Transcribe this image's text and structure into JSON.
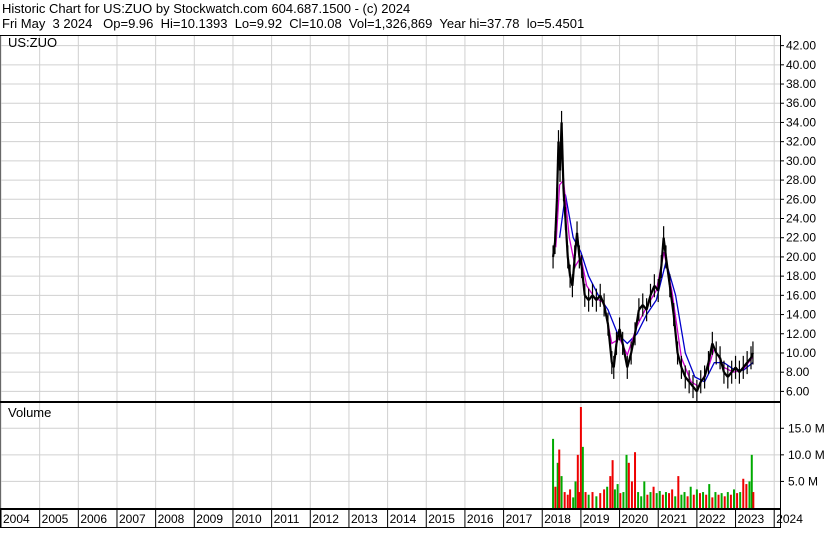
{
  "header": {
    "line1": "Historic Chart for US:ZUO by Stockwatch.com 604.687.1500 - (c) 2024",
    "line2": "Fri May  3 2024   Op=9.96  Hi=10.1393  Lo=9.92  Cl=10.08  Vol=1,326,869  Year hi=37.78  lo=5.4501"
  },
  "chart_data": {
    "type": "line",
    "symbol_label": "US:ZUO",
    "volume_label": "Volume",
    "x_tick_labels": [
      "2004",
      "2005",
      "2006",
      "2007",
      "2008",
      "2009",
      "2010",
      "2011",
      "2012",
      "2013",
      "2014",
      "2015",
      "2016",
      "2017",
      "2018",
      "2019",
      "2020",
      "2021",
      "2022",
      "2023",
      "2024"
    ],
    "price_axis": {
      "ylim": [
        5,
        43
      ],
      "tick_labels": [
        "42.00",
        "40.00",
        "38.00",
        "36.00",
        "34.00",
        "32.00",
        "30.00",
        "28.00",
        "26.00",
        "24.00",
        "22.00",
        "20.00",
        "18.00",
        "16.00",
        "14.00",
        "12.00",
        "10.00",
        "8.00",
        "6.00"
      ]
    },
    "volume_axis": {
      "ylim": [
        0,
        19000000
      ],
      "tick_labels": [
        "15.0 M",
        "10.0 M",
        "5.0 M"
      ]
    },
    "price_points": [
      {
        "x": 2018.28,
        "y": 20.0
      },
      {
        "x": 2018.33,
        "y": 21.5
      },
      {
        "x": 2018.38,
        "y": 26.0
      },
      {
        "x": 2018.42,
        "y": 32.0
      },
      {
        "x": 2018.46,
        "y": 29.0
      },
      {
        "x": 2018.5,
        "y": 34.0
      },
      {
        "x": 2018.55,
        "y": 27.0
      },
      {
        "x": 2018.6,
        "y": 24.0
      },
      {
        "x": 2018.66,
        "y": 20.0
      },
      {
        "x": 2018.72,
        "y": 18.0
      },
      {
        "x": 2018.78,
        "y": 17.0
      },
      {
        "x": 2018.84,
        "y": 20.0
      },
      {
        "x": 2018.9,
        "y": 22.5
      },
      {
        "x": 2018.96,
        "y": 20.0
      },
      {
        "x": 2019.02,
        "y": 19.0
      },
      {
        "x": 2019.1,
        "y": 16.0
      },
      {
        "x": 2019.2,
        "y": 15.5
      },
      {
        "x": 2019.3,
        "y": 16.0
      },
      {
        "x": 2019.4,
        "y": 15.5
      },
      {
        "x": 2019.5,
        "y": 16.0
      },
      {
        "x": 2019.6,
        "y": 15.0
      },
      {
        "x": 2019.7,
        "y": 13.0
      },
      {
        "x": 2019.8,
        "y": 9.0
      },
      {
        "x": 2019.85,
        "y": 8.5
      },
      {
        "x": 2019.92,
        "y": 11.0
      },
      {
        "x": 2020.0,
        "y": 12.5
      },
      {
        "x": 2020.08,
        "y": 11.0
      },
      {
        "x": 2020.2,
        "y": 8.5
      },
      {
        "x": 2020.3,
        "y": 10.0
      },
      {
        "x": 2020.4,
        "y": 12.0
      },
      {
        "x": 2020.5,
        "y": 14.5
      },
      {
        "x": 2020.6,
        "y": 15.0
      },
      {
        "x": 2020.7,
        "y": 14.5
      },
      {
        "x": 2020.8,
        "y": 16.0
      },
      {
        "x": 2020.9,
        "y": 17.0
      },
      {
        "x": 2021.0,
        "y": 16.5
      },
      {
        "x": 2021.08,
        "y": 19.0
      },
      {
        "x": 2021.14,
        "y": 22.0
      },
      {
        "x": 2021.2,
        "y": 20.0
      },
      {
        "x": 2021.3,
        "y": 17.0
      },
      {
        "x": 2021.4,
        "y": 14.0
      },
      {
        "x": 2021.5,
        "y": 10.0
      },
      {
        "x": 2021.6,
        "y": 8.5
      },
      {
        "x": 2021.7,
        "y": 7.5
      },
      {
        "x": 2021.8,
        "y": 7.0
      },
      {
        "x": 2021.9,
        "y": 6.5
      },
      {
        "x": 2022.0,
        "y": 6.0
      },
      {
        "x": 2022.1,
        "y": 7.0
      },
      {
        "x": 2022.2,
        "y": 7.5
      },
      {
        "x": 2022.3,
        "y": 9.0
      },
      {
        "x": 2022.4,
        "y": 11.0
      },
      {
        "x": 2022.5,
        "y": 10.0
      },
      {
        "x": 2022.6,
        "y": 9.5
      },
      {
        "x": 2022.7,
        "y": 8.0
      },
      {
        "x": 2022.8,
        "y": 7.5
      },
      {
        "x": 2022.9,
        "y": 8.0
      },
      {
        "x": 2023.0,
        "y": 8.5
      },
      {
        "x": 2023.1,
        "y": 8.0
      },
      {
        "x": 2023.2,
        "y": 8.5
      },
      {
        "x": 2023.3,
        "y": 9.0
      },
      {
        "x": 2023.4,
        "y": 9.5
      },
      {
        "x": 2023.45,
        "y": 10.0
      }
    ],
    "moving_average_1": [
      {
        "x": 2018.35,
        "y": 21.0
      },
      {
        "x": 2018.45,
        "y": 27.5
      },
      {
        "x": 2018.55,
        "y": 28.0
      },
      {
        "x": 2018.7,
        "y": 22.0
      },
      {
        "x": 2018.85,
        "y": 19.0
      },
      {
        "x": 2019.0,
        "y": 20.0
      },
      {
        "x": 2019.15,
        "y": 17.0
      },
      {
        "x": 2019.35,
        "y": 15.8
      },
      {
        "x": 2019.6,
        "y": 15.2
      },
      {
        "x": 2019.8,
        "y": 11.0
      },
      {
        "x": 2020.0,
        "y": 11.5
      },
      {
        "x": 2020.2,
        "y": 9.8
      },
      {
        "x": 2020.45,
        "y": 12.8
      },
      {
        "x": 2020.7,
        "y": 14.8
      },
      {
        "x": 2020.95,
        "y": 16.5
      },
      {
        "x": 2021.15,
        "y": 20.5
      },
      {
        "x": 2021.35,
        "y": 16.5
      },
      {
        "x": 2021.6,
        "y": 9.5
      },
      {
        "x": 2021.85,
        "y": 7.0
      },
      {
        "x": 2022.05,
        "y": 6.5
      },
      {
        "x": 2022.3,
        "y": 8.5
      },
      {
        "x": 2022.45,
        "y": 10.5
      },
      {
        "x": 2022.7,
        "y": 8.5
      },
      {
        "x": 2022.95,
        "y": 8.0
      },
      {
        "x": 2023.2,
        "y": 8.3
      },
      {
        "x": 2023.45,
        "y": 9.6
      }
    ],
    "moving_average_2": [
      {
        "x": 2018.45,
        "y": 22.0
      },
      {
        "x": 2018.6,
        "y": 26.5
      },
      {
        "x": 2018.8,
        "y": 22.0
      },
      {
        "x": 2019.0,
        "y": 20.5
      },
      {
        "x": 2019.2,
        "y": 18.0
      },
      {
        "x": 2019.45,
        "y": 16.0
      },
      {
        "x": 2019.7,
        "y": 14.5
      },
      {
        "x": 2019.95,
        "y": 12.0
      },
      {
        "x": 2020.2,
        "y": 11.0
      },
      {
        "x": 2020.45,
        "y": 12.0
      },
      {
        "x": 2020.7,
        "y": 14.0
      },
      {
        "x": 2020.95,
        "y": 15.5
      },
      {
        "x": 2021.2,
        "y": 19.5
      },
      {
        "x": 2021.45,
        "y": 16.0
      },
      {
        "x": 2021.7,
        "y": 10.0
      },
      {
        "x": 2021.95,
        "y": 7.5
      },
      {
        "x": 2022.2,
        "y": 7.0
      },
      {
        "x": 2022.45,
        "y": 9.0
      },
      {
        "x": 2022.7,
        "y": 9.0
      },
      {
        "x": 2022.95,
        "y": 8.3
      },
      {
        "x": 2023.2,
        "y": 8.2
      },
      {
        "x": 2023.45,
        "y": 9.0
      }
    ],
    "volume_bars": [
      {
        "x": 2018.28,
        "v": 13000000,
        "up": true
      },
      {
        "x": 2018.34,
        "v": 4000000,
        "up": false
      },
      {
        "x": 2018.4,
        "v": 8500000,
        "up": true
      },
      {
        "x": 2018.44,
        "v": 11000000,
        "up": false
      },
      {
        "x": 2018.5,
        "v": 6000000,
        "up": true
      },
      {
        "x": 2018.58,
        "v": 3000000,
        "up": false
      },
      {
        "x": 2018.66,
        "v": 2500000,
        "up": false
      },
      {
        "x": 2018.72,
        "v": 3500000,
        "up": false
      },
      {
        "x": 2018.8,
        "v": 2000000,
        "up": true
      },
      {
        "x": 2018.86,
        "v": 5000000,
        "up": true
      },
      {
        "x": 2018.92,
        "v": 10000000,
        "up": false
      },
      {
        "x": 2018.96,
        "v": 3000000,
        "up": false
      },
      {
        "x": 2019.0,
        "v": 19000000,
        "up": false
      },
      {
        "x": 2019.05,
        "v": 11500000,
        "up": true
      },
      {
        "x": 2019.12,
        "v": 3000000,
        "up": false
      },
      {
        "x": 2019.2,
        "v": 2500000,
        "up": true
      },
      {
        "x": 2019.3,
        "v": 3000000,
        "up": false
      },
      {
        "x": 2019.4,
        "v": 2200000,
        "up": true
      },
      {
        "x": 2019.5,
        "v": 2800000,
        "up": false
      },
      {
        "x": 2019.6,
        "v": 3500000,
        "up": false
      },
      {
        "x": 2019.68,
        "v": 4000000,
        "up": true
      },
      {
        "x": 2019.76,
        "v": 6000000,
        "up": false
      },
      {
        "x": 2019.82,
        "v": 9000000,
        "up": false
      },
      {
        "x": 2019.88,
        "v": 3500000,
        "up": true
      },
      {
        "x": 2019.95,
        "v": 4500000,
        "up": true
      },
      {
        "x": 2020.02,
        "v": 2800000,
        "up": false
      },
      {
        "x": 2020.1,
        "v": 3000000,
        "up": true
      },
      {
        "x": 2020.18,
        "v": 10000000,
        "up": true
      },
      {
        "x": 2020.24,
        "v": 8500000,
        "up": false
      },
      {
        "x": 2020.32,
        "v": 5000000,
        "up": false
      },
      {
        "x": 2020.4,
        "v": 10500000,
        "up": false
      },
      {
        "x": 2020.48,
        "v": 3000000,
        "up": true
      },
      {
        "x": 2020.56,
        "v": 2200000,
        "up": true
      },
      {
        "x": 2020.64,
        "v": 5000000,
        "up": true
      },
      {
        "x": 2020.72,
        "v": 2500000,
        "up": false
      },
      {
        "x": 2020.8,
        "v": 3000000,
        "up": true
      },
      {
        "x": 2020.88,
        "v": 4000000,
        "up": false
      },
      {
        "x": 2020.96,
        "v": 2800000,
        "up": true
      },
      {
        "x": 2021.04,
        "v": 3200000,
        "up": true
      },
      {
        "x": 2021.12,
        "v": 2500000,
        "up": false
      },
      {
        "x": 2021.2,
        "v": 3000000,
        "up": true
      },
      {
        "x": 2021.28,
        "v": 2800000,
        "up": false
      },
      {
        "x": 2021.36,
        "v": 3500000,
        "up": false
      },
      {
        "x": 2021.44,
        "v": 2200000,
        "up": true
      },
      {
        "x": 2021.52,
        "v": 6000000,
        "up": false
      },
      {
        "x": 2021.6,
        "v": 2500000,
        "up": true
      },
      {
        "x": 2021.68,
        "v": 3000000,
        "up": true
      },
      {
        "x": 2021.76,
        "v": 2200000,
        "up": false
      },
      {
        "x": 2021.84,
        "v": 4000000,
        "up": true
      },
      {
        "x": 2021.92,
        "v": 2500000,
        "up": false
      },
      {
        "x": 2022.0,
        "v": 3500000,
        "up": true
      },
      {
        "x": 2022.08,
        "v": 2800000,
        "up": false
      },
      {
        "x": 2022.16,
        "v": 3000000,
        "up": true
      },
      {
        "x": 2022.24,
        "v": 2500000,
        "up": false
      },
      {
        "x": 2022.32,
        "v": 4500000,
        "up": true
      },
      {
        "x": 2022.4,
        "v": 2000000,
        "up": false
      },
      {
        "x": 2022.48,
        "v": 3000000,
        "up": true
      },
      {
        "x": 2022.56,
        "v": 2500000,
        "up": false
      },
      {
        "x": 2022.64,
        "v": 2800000,
        "up": true
      },
      {
        "x": 2022.72,
        "v": 2200000,
        "up": false
      },
      {
        "x": 2022.8,
        "v": 3000000,
        "up": true
      },
      {
        "x": 2022.88,
        "v": 2500000,
        "up": false
      },
      {
        "x": 2022.96,
        "v": 3500000,
        "up": true
      },
      {
        "x": 2023.04,
        "v": 2800000,
        "up": false
      },
      {
        "x": 2023.12,
        "v": 3000000,
        "up": true
      },
      {
        "x": 2023.2,
        "v": 5500000,
        "up": false
      },
      {
        "x": 2023.28,
        "v": 4500000,
        "up": false
      },
      {
        "x": 2023.36,
        "v": 5000000,
        "up": true
      },
      {
        "x": 2023.42,
        "v": 10000000,
        "up": true
      },
      {
        "x": 2023.46,
        "v": 3000000,
        "up": false
      }
    ],
    "colors": {
      "price_bars": "#000000",
      "ma1": "#cc00cc",
      "ma2": "#0000cc",
      "volume_up": "#00aa00",
      "volume_down": "#ee0000",
      "grid": "#d0d0d0"
    }
  }
}
